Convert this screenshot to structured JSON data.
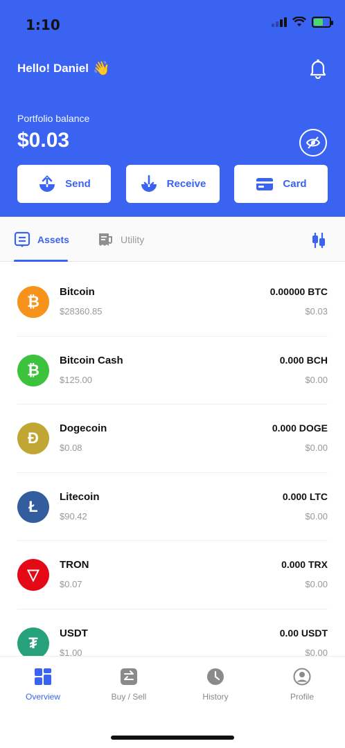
{
  "status_bar": {
    "time": "1:10"
  },
  "header": {
    "greeting": "Hello! Daniel",
    "wave_emoji": "👋",
    "balance_label": "Portfolio balance",
    "balance_value": "$0.03"
  },
  "actions": [
    {
      "label": "Send",
      "icon": "send-upload-icon"
    },
    {
      "label": "Receive",
      "icon": "receive-download-icon"
    },
    {
      "label": "Card",
      "icon": "card-icon"
    }
  ],
  "tabs": [
    {
      "label": "Assets",
      "active": true
    },
    {
      "label": "Utility",
      "active": false
    }
  ],
  "assets": [
    {
      "name": "Bitcoin",
      "price": "$28360.85",
      "amount": "0.00000 BTC",
      "fiat": "$0.03",
      "color": "#f7931a",
      "glyph": "₿"
    },
    {
      "name": "Bitcoin Cash",
      "price": "$125.00",
      "amount": "0.000 BCH",
      "fiat": "$0.00",
      "color": "#3cc23c",
      "glyph": "₿"
    },
    {
      "name": "Dogecoin",
      "price": "$0.08",
      "amount": "0.000 DOGE",
      "fiat": "$0.00",
      "color": "#c2a633",
      "glyph": "Ð"
    },
    {
      "name": "Litecoin",
      "price": "$90.42",
      "amount": "0.000 LTC",
      "fiat": "$0.00",
      "color": "#345d9d",
      "glyph": "Ł"
    },
    {
      "name": "TRON",
      "price": "$0.07",
      "amount": "0.000 TRX",
      "fiat": "$0.00",
      "color": "#e50915",
      "glyph": "▽"
    },
    {
      "name": "USDT",
      "price": "$1.00",
      "amount": "0.00 USDT",
      "fiat": "$0.00",
      "color": "#26a17b",
      "glyph": "₮"
    }
  ],
  "bottom_nav": [
    {
      "label": "Overview",
      "active": true
    },
    {
      "label": "Buy / Sell",
      "active": false
    },
    {
      "label": "History",
      "active": false
    },
    {
      "label": "Profile",
      "active": false
    }
  ],
  "colors": {
    "primary": "#3a63f2",
    "muted": "#999999"
  }
}
